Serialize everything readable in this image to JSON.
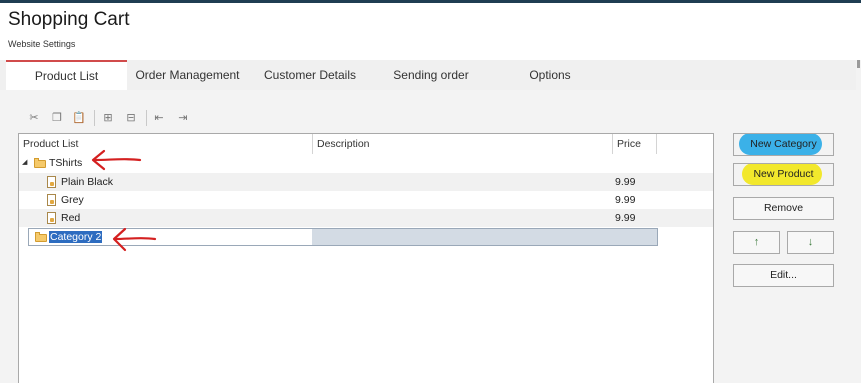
{
  "app": {
    "title": "Shopping Cart",
    "subtitle": "Website Settings"
  },
  "tabs": [
    {
      "label": "Product List",
      "active": true
    },
    {
      "label": "Order Management",
      "active": false
    },
    {
      "label": "Customer Details",
      "active": false
    },
    {
      "label": "Sending order",
      "active": false
    },
    {
      "label": "Options",
      "active": false
    }
  ],
  "toolbar": {
    "icons": [
      "cut-icon",
      "copy-icon",
      "paste-icon",
      "add-child-icon",
      "add-sibling-icon",
      "indent-icon",
      "outdent-icon"
    ]
  },
  "grid": {
    "columns": [
      "Product List",
      "Description",
      "Price"
    ],
    "rows": [
      {
        "name": "TShirts",
        "type": "category",
        "expanded": true,
        "price": ""
      },
      {
        "name": "Plain Black",
        "type": "product",
        "price": "9.99"
      },
      {
        "name": "Grey",
        "type": "product",
        "price": "9.99"
      },
      {
        "name": "Red",
        "type": "product",
        "price": "9.99"
      },
      {
        "name": "Category 2",
        "type": "category",
        "editing": true,
        "price": ""
      }
    ]
  },
  "actions": {
    "new_category": "New Category",
    "new_product": "New Product",
    "remove": "Remove",
    "move_up": "↑",
    "move_down": "↓",
    "edit": "Edit..."
  },
  "colors": {
    "active_tab_accent": "#d14b4b",
    "selection": "#2d6cc0",
    "highlight_blue": "#3bb1e8",
    "highlight_yellow": "#f2e82c",
    "annotation_arrow": "#d42020"
  }
}
